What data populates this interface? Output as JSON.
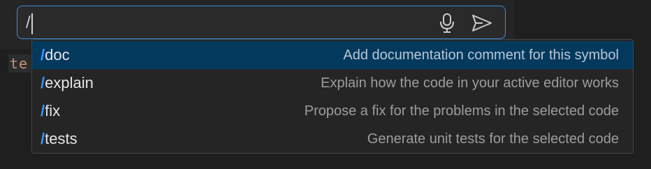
{
  "input": {
    "value": "/"
  },
  "editor": {
    "fragment": "te"
  },
  "icons": {
    "mic": "microphone-icon",
    "send": "send-icon"
  },
  "colors": {
    "accent": "#3794ff",
    "selected_row": "#04395e",
    "input_border": "#3c8bdc"
  },
  "suggestions": [
    {
      "slash": "/",
      "command": "doc",
      "description": "Add documentation comment for this symbol",
      "selected": true
    },
    {
      "slash": "/",
      "command": "explain",
      "description": "Explain how the code in your active editor works",
      "selected": false
    },
    {
      "slash": "/",
      "command": "fix",
      "description": "Propose a fix for the problems in the selected code",
      "selected": false
    },
    {
      "slash": "/",
      "command": "tests",
      "description": "Generate unit tests for the selected code",
      "selected": false
    }
  ]
}
